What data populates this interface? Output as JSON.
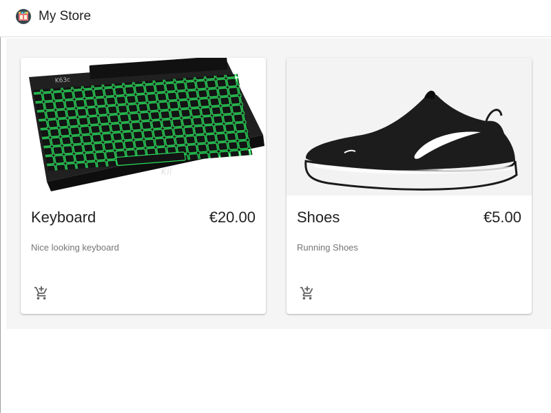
{
  "header": {
    "title": "My Store",
    "logo_icon": "store-icon"
  },
  "products": [
    {
      "name": "Keyboard",
      "price": "€20.00",
      "description": "Nice looking keyboard",
      "image_icon": "keyboard-image",
      "action_icon": "add-shopping-cart-icon"
    },
    {
      "name": "Shoes",
      "price": "€5.00",
      "description": "Running Shoes",
      "image_icon": "shoe-image",
      "action_icon": "add-shopping-cart-icon"
    }
  ],
  "colors": {
    "page_background": "#f5f5f5",
    "card_background": "#ffffff",
    "title_text": "#212121",
    "secondary_text": "#757575",
    "keyboard_backlight": "#28e05a"
  }
}
